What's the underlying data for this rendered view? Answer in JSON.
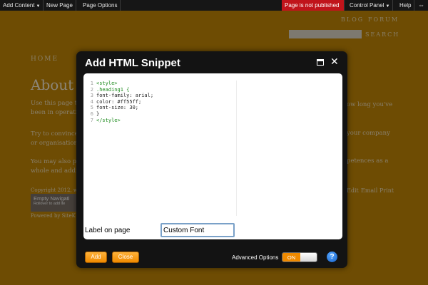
{
  "colors": {
    "site_background": "#c98a06",
    "topbar_background": "#161616",
    "publish_warning": "#c0141b",
    "button_orange": "#f08a00",
    "help_blue": "#1560c8",
    "code_green": "#1b8a1b"
  },
  "topbar": {
    "add_content": "Add Content",
    "new_page": "New Page",
    "page_options": "Page Options",
    "publish_status": "Page is not published",
    "control_panel": "Control Panel",
    "help": "Help",
    "more_icon": "double-arrow-icon"
  },
  "site": {
    "blog": "BLOG",
    "forum": "FORUM",
    "search_label": "SEARCH",
    "nav_home": "HOME",
    "heading": "About",
    "para1_left": "Use this page to",
    "para1_left2": "been in operatio",
    "para1_right": "ow long you've",
    "para2_left": "Try to convince",
    "para2_left2": "or organisation",
    "para2_right": "your company",
    "para3_left": "You may also p",
    "para3_left2": "whole and addi",
    "para3_right": "petences as a",
    "copyright": "Copyright 2012, w",
    "footer_edit": "Edit",
    "footer_email": "Email",
    "footer_print": "Print",
    "empty_nav_title": "Empty Navigati",
    "empty_nav_hint": "Rollover to add ite",
    "powered": "Powered by SiteK"
  },
  "modal": {
    "title": "Add HTML Snippet",
    "maximize_icon": "maximize-icon",
    "close_icon": "close-icon",
    "code_lines": [
      {
        "num": "1",
        "text": "<style>"
      },
      {
        "num": "2",
        "text": ".heading1 {"
      },
      {
        "num": "3",
        "text": "font-family: arial;"
      },
      {
        "num": "4",
        "text": "color: #ff55ff;"
      },
      {
        "num": "5",
        "text": "font-size: 30;"
      },
      {
        "num": "6",
        "text": "}"
      },
      {
        "num": "7",
        "text": "</style>"
      }
    ],
    "label_on_page": "Label on page",
    "label_value": "Custom Font",
    "add_button": "Add",
    "close_button": "Close",
    "advanced_options": "Advanced Options",
    "toggle_state": "ON",
    "help_icon": "?"
  }
}
